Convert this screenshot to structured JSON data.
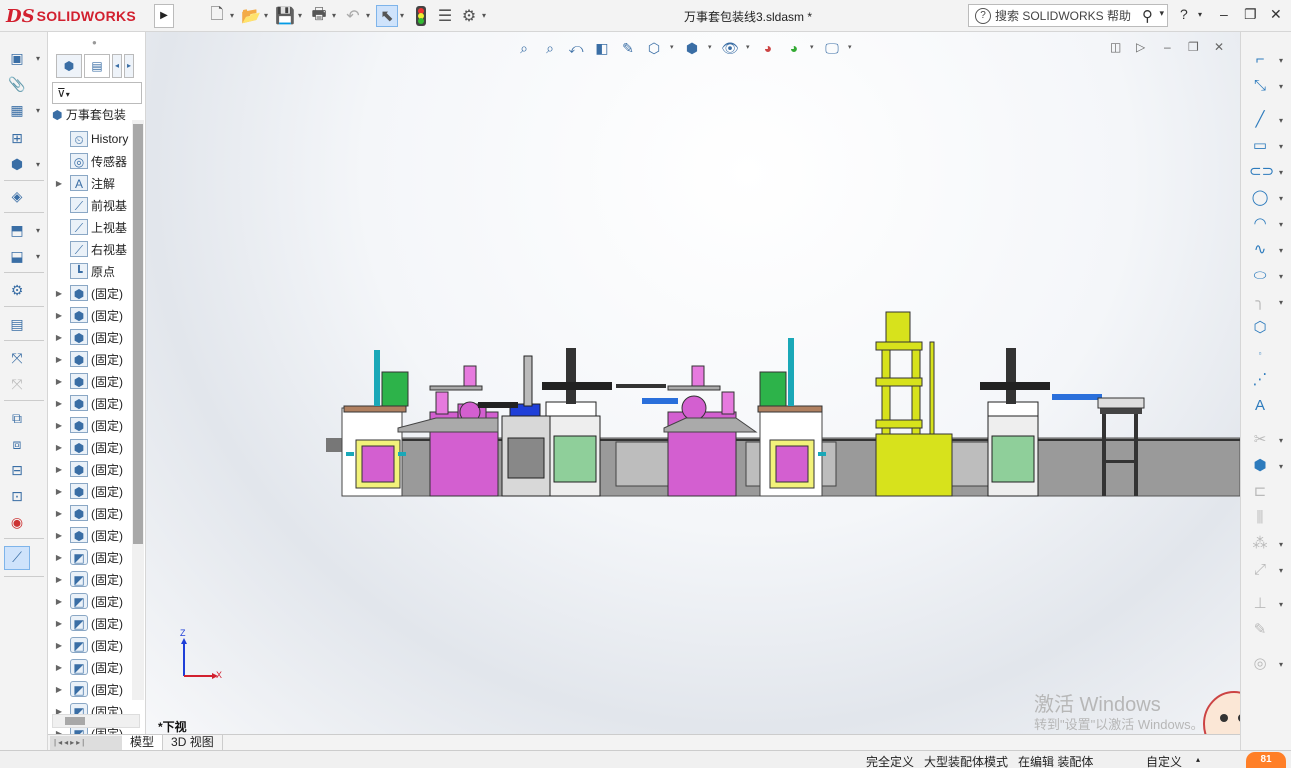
{
  "app": {
    "brand_prefix": "DS",
    "brand_name": "SOLIDWORKS",
    "document_title": "万事套包装线3.sldasm *"
  },
  "toolbar": {
    "icons": [
      "new-document-icon",
      "open-folder-icon",
      "save-icon",
      "print-icon",
      "undo-icon",
      "select-pointer-icon",
      "rebuild-traffic-light-icon",
      "file-properties-icon",
      "options-gear-icon"
    ]
  },
  "search": {
    "placeholder": "搜索 SOLIDWORKS 帮助",
    "help_glyph": "?"
  },
  "feature_tree": {
    "root_label": "万事套包装",
    "items": [
      {
        "label": "History",
        "icon": "history-icon",
        "expandable": false
      },
      {
        "label": "传感器",
        "icon": "sensor-icon",
        "expandable": false
      },
      {
        "label": "注解",
        "icon": "annotation-icon",
        "expandable": true
      },
      {
        "label": "前视基",
        "icon": "plane-icon",
        "expandable": false
      },
      {
        "label": "上视基",
        "icon": "plane-icon",
        "expandable": false
      },
      {
        "label": "右视基",
        "icon": "plane-icon",
        "expandable": false
      },
      {
        "label": "原点",
        "icon": "origin-icon",
        "expandable": false
      },
      {
        "label": "(固定)",
        "icon": "assembly-icon",
        "expandable": true
      },
      {
        "label": "(固定)",
        "icon": "assembly-icon",
        "expandable": true
      },
      {
        "label": "(固定)",
        "icon": "assembly-icon",
        "expandable": true
      },
      {
        "label": "(固定)",
        "icon": "assembly-icon",
        "expandable": true
      },
      {
        "label": "(固定)",
        "icon": "assembly-icon",
        "expandable": true
      },
      {
        "label": "(固定)",
        "icon": "assembly-icon",
        "expandable": true
      },
      {
        "label": "(固定)",
        "icon": "assembly-icon",
        "expandable": true
      },
      {
        "label": "(固定)",
        "icon": "assembly-icon",
        "expandable": true
      },
      {
        "label": "(固定)",
        "icon": "assembly-icon",
        "expandable": true
      },
      {
        "label": "(固定)",
        "icon": "assembly-icon",
        "expandable": true
      },
      {
        "label": "(固定)",
        "icon": "assembly-icon",
        "expandable": true
      },
      {
        "label": "(固定)",
        "icon": "assembly-icon",
        "expandable": true
      },
      {
        "label": "(固定)",
        "icon": "part-icon",
        "expandable": true
      },
      {
        "label": "(固定)",
        "icon": "part-icon",
        "expandable": true
      },
      {
        "label": "(固定)",
        "icon": "part-icon",
        "expandable": true
      },
      {
        "label": "(固定)",
        "icon": "part-icon",
        "expandable": true
      },
      {
        "label": "(固定)",
        "icon": "part-icon",
        "expandable": true
      },
      {
        "label": "(固定)",
        "icon": "part-icon",
        "expandable": true
      },
      {
        "label": "(固定)",
        "icon": "part-icon",
        "expandable": true
      },
      {
        "label": "(固定)",
        "icon": "part-icon",
        "expandable": true
      },
      {
        "label": "(固定)",
        "icon": "part-icon",
        "expandable": true
      }
    ]
  },
  "graphics": {
    "view_name": "*下视",
    "triad": {
      "z": "Z",
      "x": "X"
    },
    "watermark_line1": "激活 Windows",
    "watermark_line2": "转到\"设置\"以激活 Windows。",
    "colors": {
      "magenta": "#d35fd0",
      "green": "#2db34a",
      "yellow": "#d7e21c",
      "blue": "#1f3fd8",
      "grey": "#9a9a9a",
      "teal": "#1aa8b8"
    }
  },
  "bottom_tabs": [
    {
      "label": "模型",
      "active": true
    },
    {
      "label": "3D 视图",
      "active": false
    }
  ],
  "status": {
    "fully_defined": "完全定义",
    "large_assembly": "大型装配体模式",
    "editing": "在编辑 装配体",
    "custom": "自定义",
    "badge": "81"
  }
}
